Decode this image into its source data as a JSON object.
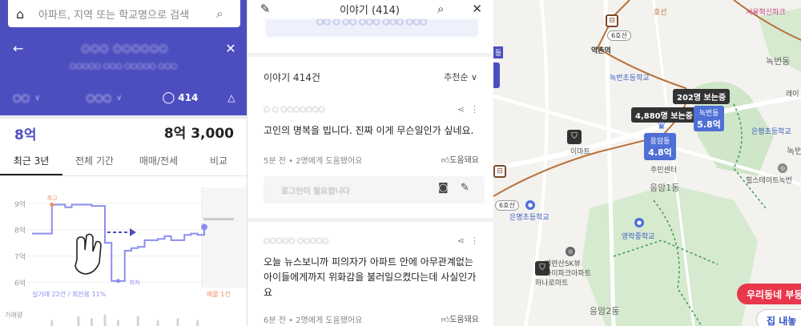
{
  "left": {
    "search_placeholder": "아파트, 지역 또는 학교명으로 검색",
    "apt_title": "○○○ ○○○○○○",
    "apt_address": "○○○○○ ○○○ ○○○○○ ○○○",
    "header_tabs": {
      "type": "○○",
      "size": "○○○",
      "story_count": "414"
    },
    "price_low": "8억",
    "price_high": "8억 3,000",
    "period_tabs": [
      "최근 3년",
      "전체 기간",
      "매매/전세",
      "비교"
    ],
    "active_period_tab": 0
  },
  "chart_data": {
    "type": "line",
    "y_ticks": [
      "9억",
      "8억",
      "7억",
      "6억"
    ],
    "ylim": [
      5.8,
      9.3
    ],
    "max_label": "최고",
    "min_label": "최저",
    "series": [
      {
        "values": [
          7.85,
          7.85,
          7.85,
          8.95,
          8.95,
          8.85,
          8.95,
          8.95,
          8.95,
          8.9,
          8.9,
          7.5,
          6.05,
          6.05,
          7.2,
          7.3,
          7.35,
          7.6,
          7.6,
          7.65,
          7.75,
          7.6,
          7.6,
          7.8,
          7.85,
          7.8,
          8.1
        ]
      }
    ],
    "footer_left": "실거래 22건 / 최전용 11%",
    "footer_right": "매물 1건",
    "volume_label": "거래량",
    "volume": [
      0,
      0,
      0,
      0.3,
      0,
      0,
      0,
      0.5,
      0,
      0.4,
      0,
      0.6,
      0,
      0.3,
      0,
      0,
      0.5,
      0,
      0,
      0.3,
      0,
      0,
      0.4,
      0,
      0,
      0.3,
      0
    ]
  },
  "mid": {
    "title": "이야기 (414)",
    "banner_text": "○○ ○ ○○ ○○○ ○○○ ○○○",
    "count_label": "이야기 414건",
    "sort_label": "추천순 ∨",
    "posts": [
      {
        "user": "○ ○ ○○○○○○○",
        "text": "고인의 명복을 빕니다. 진짜 이게 무슨일인가 싶네요.",
        "meta": "5분 전 • 2명에게 도움됐어요",
        "help": "도움돼요",
        "comment_placeholder": "로그인이 필요합니다"
      },
      {
        "user": "○○○○○ ○○○○○",
        "text": "오늘 뉴스보니까 피의자가 아파트 안에 아무관계없는 아이들에게까지 위화감을 불러일으켰다는데 사실인가요",
        "meta": "6분 전 • 2명에게 도움됐어요",
        "help": "도움돼요"
      }
    ]
  },
  "map": {
    "labels": {
      "seoul_school": "서울혁신파크",
      "line6_a": "6호선",
      "yeokchon": "역촌역",
      "nokbeon_dong": "녹번동",
      "nokbeon_center": "녹번초등학교",
      "baram": "레이",
      "eunpyeong_elem": "은평초등학교",
      "emart": "이마트",
      "jumin": "주민센터",
      "eungam1": "응암1동",
      "hills": "힐스테이트녹번",
      "line6_b": "6호선",
      "eunmyeong": "은명초등학교",
      "yeongrak": "영락중학교",
      "baekryeon": "백련산SK뷰",
      "baekryeon2": "아이파크아파트",
      "hanaro": "하나로마트",
      "eungam2": "응암2동",
      "nokbeon_side": "녹번",
      "hoseon": "호선",
      "dong_edge": "동"
    },
    "bubble_viewers_1": "202명 보는중",
    "bubble_viewers_2": "4,880명 보는중",
    "price_markers": [
      {
        "name": "녹번동",
        "value": "5.8억"
      },
      {
        "name": "응암동",
        "value": "4.8억"
      }
    ],
    "promo_top": "우리동네 부동",
    "promo_bottom": "집 내놓"
  },
  "colors": {
    "brand": "#4c4ec0",
    "promo_red": "#e8364a",
    "chart_line": "#8c8ef0"
  }
}
